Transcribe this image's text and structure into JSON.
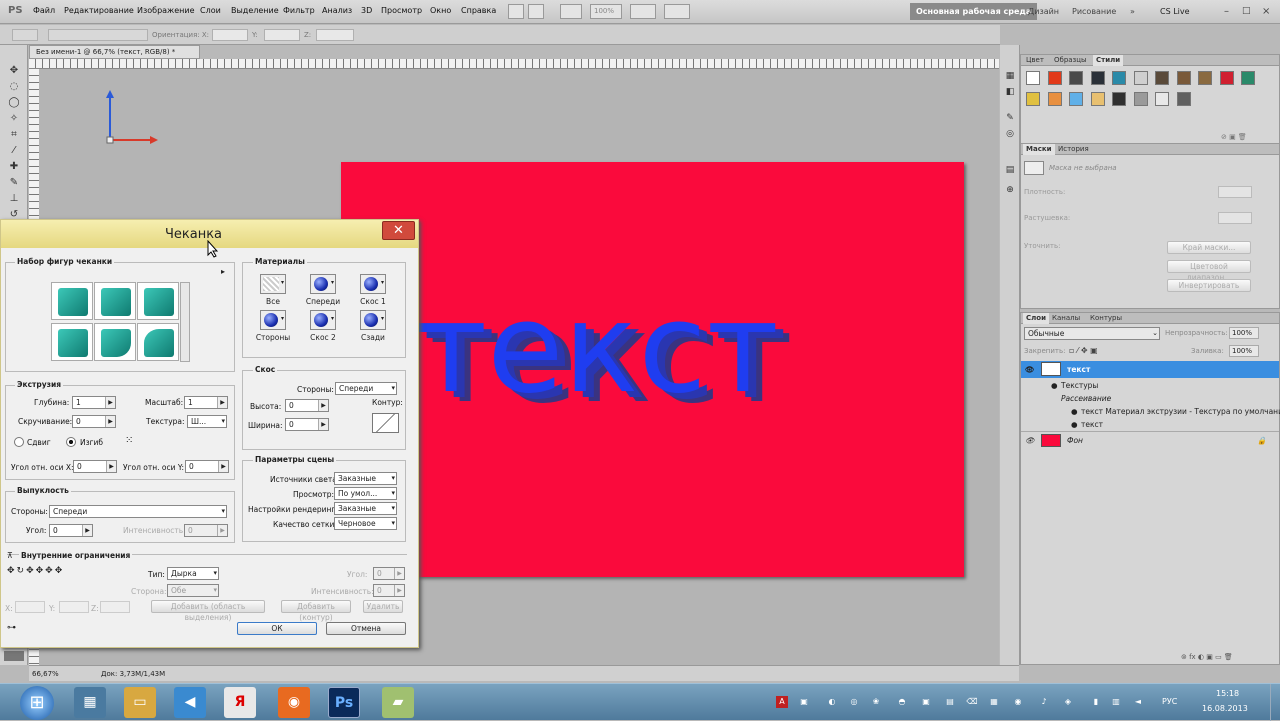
{
  "app": {
    "logo": "PS",
    "menu": [
      "Файл",
      "Редактирование",
      "Изображение",
      "Слои",
      "Выделение",
      "Фильтр",
      "Анализ",
      "3D",
      "Просмотр",
      "Окно",
      "Справка"
    ],
    "zoom_field": "100%",
    "workspaces": [
      "Основная рабочая среда",
      "Дизайн",
      "Рисование"
    ],
    "cs_live": "CS Live"
  },
  "options_bar": {
    "orientation_label": "Ориентация: X:",
    "y_label": "Y:",
    "z_label": "Z:"
  },
  "document": {
    "tab_title": "Без имени-1 @ 66,7% (текст, RGB/8) *",
    "canvas_text": "текст",
    "canvas_color": "#fa0a3c",
    "text_color": "#1f3df0",
    "status_zoom": "66,67%",
    "status_doc": "Док: 3,73M/1,43M"
  },
  "dialog": {
    "title": "Чеканка",
    "shapes_group": "Набор фигур чеканки",
    "extrusion": {
      "label": "Экструзия",
      "depth_label": "Глубина:",
      "depth": "1",
      "scale_label": "Масштаб:",
      "scale": "1",
      "twist_label": "Скручивание:",
      "twist": "0",
      "texture_label": "Текстура:",
      "texture": "Ш...",
      "shear_label": "Сдвиг",
      "bend_label": "Изгиб",
      "xangle_label": "Угол отн. оси X:",
      "xangle": "0",
      "yangle_label": "Угол отн. оси Y:",
      "yangle": "0"
    },
    "inflate": {
      "label": "Выпуклость",
      "sides_label": "Стороны:",
      "sides": "Спереди",
      "angle_label": "Угол:",
      "angle": "0",
      "intensity_label": "Интенсивность:",
      "intensity": "0"
    },
    "inner": {
      "label": "Внутренние ограничения",
      "type_label": "Тип:",
      "type": "Дырка",
      "side_label": "Сторона:",
      "side": "Обе",
      "angle_label": "Угол:",
      "angle": "0",
      "intensity_label": "Интенсивность:",
      "intensity": "0",
      "x_label": "X:",
      "y_label": "Y:",
      "z_label": "Z:",
      "add_selection": "Добавить (область выделения)",
      "add_contour": "Добавить (контур)",
      "delete": "Удалить"
    },
    "materials": {
      "label": "Материалы",
      "items": [
        "Все",
        "Спереди",
        "Скос 1",
        "Стороны",
        "Скос 2",
        "Сзади"
      ]
    },
    "bevel": {
      "label": "Скос",
      "sides_label": "Стороны:",
      "sides": "Спереди",
      "height_label": "Высота:",
      "height": "0",
      "contour_label": "Контур:",
      "width_label": "Ширина:",
      "width": "0"
    },
    "scene": {
      "label": "Параметры сцены",
      "lights_label": "Источники света:",
      "lights": "Заказные",
      "view_label": "Просмотр:",
      "view": "По умол...",
      "render_label": "Настройки рендеринга:",
      "render": "Заказные",
      "mesh_label": "Качество сетки:",
      "mesh": "Черновое"
    },
    "ok": "ОК",
    "cancel": "Отмена"
  },
  "styles_panel": {
    "tabs": [
      "Цвет",
      "Образцы",
      "Стили"
    ],
    "swatches_row1": [
      "#ffffff",
      "#e23a1a",
      "#4a4a4a",
      "#2a3038",
      "#2a8aa8",
      "#cfcfcf",
      "#5a4a3a",
      "#7a5a3a",
      "#8a6a40",
      "#d02030",
      "#2a8a6a"
    ],
    "swatches_row2": [
      "#e0c040",
      "#e89040",
      "#60b0e8",
      "#e8c070",
      "#303030",
      "#9a9a9a",
      "#e8e8e8",
      "#606060"
    ]
  },
  "masks_panel": {
    "tabs": [
      "Маски",
      "История"
    ],
    "no_mask": "Маска не выбрана",
    "density_label": "Плотность:",
    "feather_label": "Растушевка:",
    "refine_label": "Уточнить:",
    "mask_edge": "Край маски...",
    "color_range": "Цветовой диапазон...",
    "invert": "Инвертировать"
  },
  "layers_panel": {
    "tabs": [
      "Слои",
      "Каналы",
      "Контуры"
    ],
    "blend_mode": "Обычные",
    "opacity_label": "Непрозрачность:",
    "opacity": "100%",
    "lock_label": "Закрепить:",
    "fill_label": "Заливка:",
    "fill": "100%",
    "layers": [
      {
        "name": "текст",
        "type": "3d"
      },
      {
        "name": "Текстуры",
        "type": "sub"
      },
      {
        "name": "Рассеивание",
        "type": "sub2"
      },
      {
        "name": "текст Материал экструзии - Текстура по умолчанию",
        "type": "sub3"
      },
      {
        "name": "текст",
        "type": "sub3"
      },
      {
        "name": "Фон",
        "type": "bg"
      }
    ]
  },
  "taskbar": {
    "language": "РУС",
    "time": "15:18",
    "date": "16.08.2013"
  }
}
